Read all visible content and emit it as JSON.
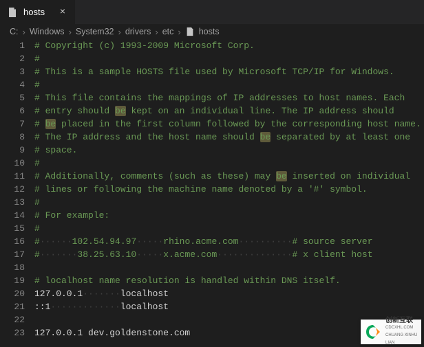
{
  "tab": {
    "label": "hosts"
  },
  "breadcrumb": {
    "segments": [
      "C:",
      "Windows",
      "System32",
      "drivers",
      "etc",
      "hosts"
    ]
  },
  "code": {
    "lines": [
      {
        "n": 1,
        "t": "comment",
        "s": "# Copyright (c) 1993-2009 Microsoft Corp."
      },
      {
        "n": 2,
        "t": "comment",
        "s": "#"
      },
      {
        "n": 3,
        "t": "comment",
        "s": "# This is a sample HOSTS file used by Microsoft TCP/IP for Windows."
      },
      {
        "n": 4,
        "t": "comment",
        "s": "#"
      },
      {
        "n": 5,
        "t": "comment",
        "s": "# This file contains the mappings of IP addresses to host names. Each"
      },
      {
        "n": 6,
        "t": "comment",
        "s": "# entry should ",
        "hl": "be",
        "s2": " kept on an individual line. The IP address should"
      },
      {
        "n": 7,
        "t": "comment",
        "s": "# ",
        "hl": "be",
        "s2": " placed in the first column followed by the corresponding host name."
      },
      {
        "n": 8,
        "t": "comment",
        "s": "# The IP address and the host name should ",
        "hl": "be",
        "s2": " separated by at least one"
      },
      {
        "n": 9,
        "t": "comment",
        "s": "# space."
      },
      {
        "n": 10,
        "t": "comment",
        "s": "#"
      },
      {
        "n": 11,
        "t": "comment",
        "s": "# Additionally, comments (such as these) may ",
        "hl": "be",
        "s2": " inserted on individual"
      },
      {
        "n": 12,
        "t": "comment",
        "s": "# lines or following the machine name denoted by a '#' symbol."
      },
      {
        "n": 13,
        "t": "comment",
        "s": "#"
      },
      {
        "n": 14,
        "t": "comment",
        "s": "# For example:"
      },
      {
        "n": 15,
        "t": "comment",
        "s": "#"
      },
      {
        "n": 16,
        "t": "pad",
        "s": "#",
        "ws1": "······",
        "s2": "102.54.94.97",
        "ws2": "·····",
        "s3": "rhino.acme.com",
        "ws3": "··········",
        "s4": "# source server"
      },
      {
        "n": 17,
        "t": "pad",
        "s": "#",
        "ws1": "·······",
        "s2": "38.25.63.10",
        "ws2": "·····",
        "s3": "x.acme.com",
        "ws3": "··············",
        "s4": "# x client host"
      },
      {
        "n": 18,
        "t": "blank",
        "s": ""
      },
      {
        "n": 19,
        "t": "comment",
        "s": "# localhost name resolution is handled within DNS itself."
      },
      {
        "n": 20,
        "t": "plainws",
        "s": "127.0.0.1",
        "ws1": "·······",
        "s2": "localhost"
      },
      {
        "n": 21,
        "t": "plainws",
        "s": "::1",
        "ws1": "·············",
        "s2": "localhost"
      },
      {
        "n": 22,
        "t": "blank",
        "s": ""
      },
      {
        "n": 23,
        "t": "plain",
        "s": "127.0.0.1 dev.goldenstone.com"
      }
    ]
  },
  "watermark": {
    "title": "创新互联",
    "sub": "CDCXHL.COM CHUANG XINHU LIAN"
  }
}
